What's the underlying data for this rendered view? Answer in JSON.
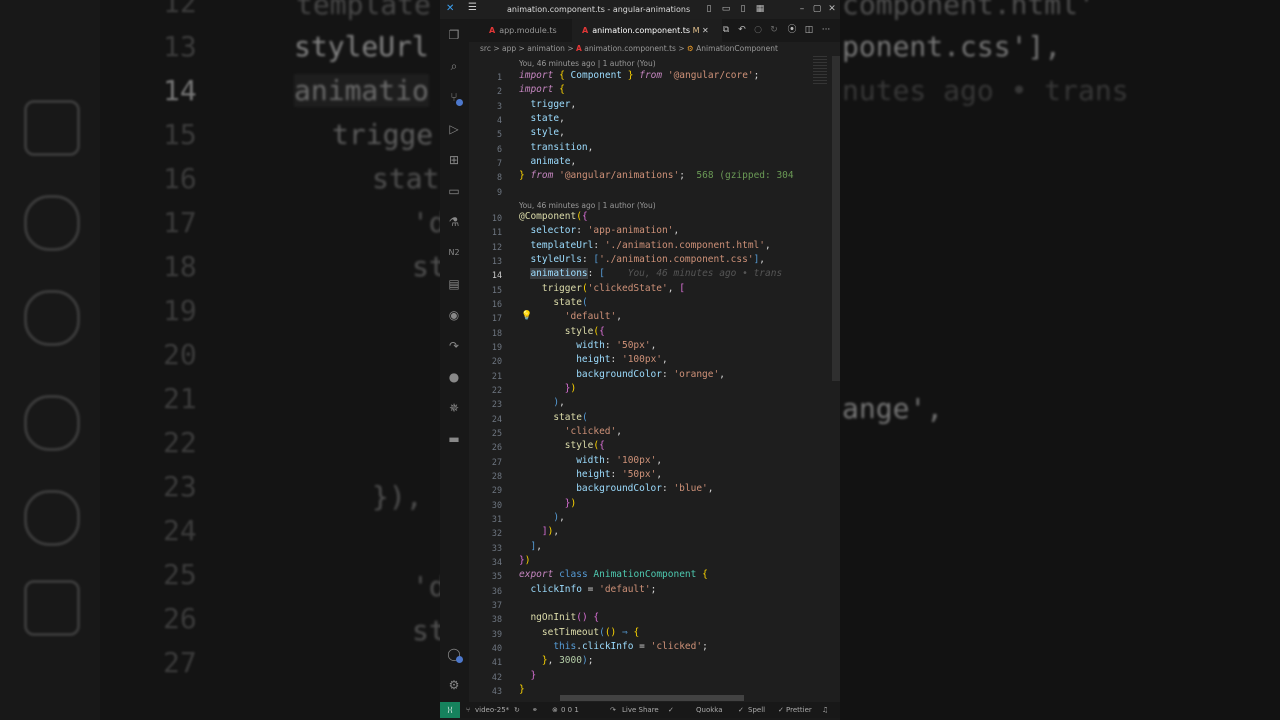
{
  "window_title": "animation.component.ts - angular-animations - Visu...",
  "tabs": [
    {
      "label": "app.module.ts",
      "active": false
    },
    {
      "label": "animation.component.ts",
      "modified": "M",
      "active": true
    }
  ],
  "breadcrumb": {
    "parts": [
      "src",
      "app",
      "animation",
      "animation.component.ts",
      "AnimationComponent"
    ],
    "separator": ">"
  },
  "codelens": "You, 46 minutes ago | 1 author (You)",
  "inline_hints": {
    "gzip": "568 (gzipped: 304",
    "blame": "You, 46 minutes ago • trans"
  },
  "line_numbers": [
    "1",
    "2",
    "3",
    "4",
    "5",
    "6",
    "7",
    "8",
    "9",
    "10",
    "11",
    "12",
    "13",
    "14",
    "15",
    "16",
    "17",
    "18",
    "19",
    "20",
    "21",
    "22",
    "23",
    "24",
    "25",
    "26",
    "27",
    "28",
    "29",
    "30",
    "31",
    "32",
    "33",
    "34",
    "35",
    "36",
    "37",
    "38",
    "39",
    "40",
    "41",
    "42",
    "43"
  ],
  "active_line": "14",
  "statusbar": {
    "branch": "video-25*",
    "problems": "0 0 1",
    "live_share": "Live Share",
    "quokka": "Quokka",
    "spell": "Spell",
    "prettier": "Prettier"
  },
  "activity_icons": [
    "explorer-icon",
    "search-icon",
    "source-control-icon",
    "run-debug-icon",
    "extensions-icon",
    "remote-explorer-icon",
    "testing-icon",
    "angular-icon",
    "notes-icon",
    "git-graph-icon",
    "live-share-icon",
    "github-icon",
    "kubernetes-icon",
    "docker-icon",
    "account-icon",
    "settings-icon"
  ],
  "background": {
    "numbers": [
      "12",
      "13",
      "14",
      "15",
      "16",
      "17",
      "18",
      "19",
      "20",
      "21",
      "22",
      "23",
      "24",
      "25",
      "26",
      "27"
    ],
    "text_lines": [
      "template",
      "styleUrl",
      "animatio",
      "trigge",
      "stat",
      "'d",
      "st",
      "}),",
      "'d",
      "st",
      "component.html'",
      "ponent.css'],",
      "nutes ago • trans",
      "ange',"
    ]
  },
  "colors": {
    "editor_bg": "#1e1e1e",
    "remote_indicator": "#16825d",
    "keyword": "#c586c0",
    "string": "#ce9178"
  }
}
